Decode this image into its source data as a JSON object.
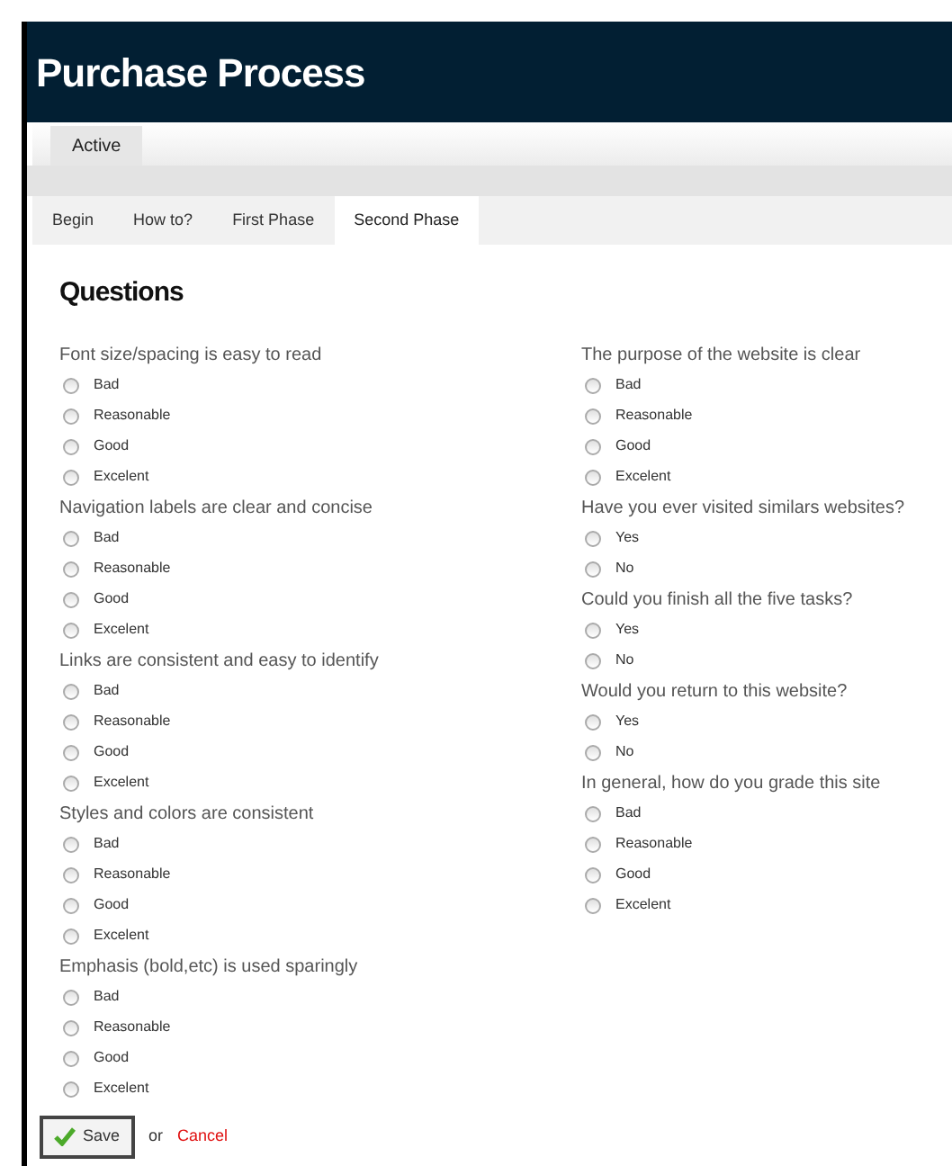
{
  "header": {
    "title": "Purchase Process"
  },
  "top_tabs": [
    {
      "label": "Active",
      "selected": true
    }
  ],
  "phase_tabs": [
    {
      "label": "Begin",
      "selected": false
    },
    {
      "label": "How to?",
      "selected": false
    },
    {
      "label": "First Phase",
      "selected": false
    },
    {
      "label": "Second Phase",
      "selected": true
    }
  ],
  "section_title": "Questions",
  "columns": [
    [
      {
        "question": "Font size/spacing is easy to read",
        "options": [
          {
            "label": "Bad",
            "selected": false
          },
          {
            "label": "Reasonable",
            "selected": false
          },
          {
            "label": "Good",
            "selected": false
          },
          {
            "label": "Excelent",
            "selected": false
          }
        ]
      },
      {
        "question": "Navigation labels are clear and concise",
        "options": [
          {
            "label": "Bad",
            "selected": false
          },
          {
            "label": "Reasonable",
            "selected": false
          },
          {
            "label": "Good",
            "selected": false
          },
          {
            "label": "Excelent",
            "selected": false
          }
        ]
      },
      {
        "question": "Links are consistent and easy to identify",
        "options": [
          {
            "label": "Bad",
            "selected": false
          },
          {
            "label": "Reasonable",
            "selected": false
          },
          {
            "label": "Good",
            "selected": false
          },
          {
            "label": "Excelent",
            "selected": false
          }
        ]
      },
      {
        "question": "Styles and colors are consistent",
        "options": [
          {
            "label": "Bad",
            "selected": false
          },
          {
            "label": "Reasonable",
            "selected": false
          },
          {
            "label": "Good",
            "selected": false
          },
          {
            "label": "Excelent",
            "selected": false
          }
        ]
      },
      {
        "question": "Emphasis (bold,etc) is used sparingly",
        "options": [
          {
            "label": "Bad",
            "selected": false
          },
          {
            "label": "Reasonable",
            "selected": false
          },
          {
            "label": "Good",
            "selected": false
          },
          {
            "label": "Excelent",
            "selected": false
          }
        ]
      }
    ],
    [
      {
        "question": "The purpose of the website is clear",
        "options": [
          {
            "label": "Bad",
            "selected": false
          },
          {
            "label": "Reasonable",
            "selected": false
          },
          {
            "label": "Good",
            "selected": false
          },
          {
            "label": "Excelent",
            "selected": false
          }
        ]
      },
      {
        "question": "Have you ever visited similars websites?",
        "options": [
          {
            "label": "Yes",
            "selected": false
          },
          {
            "label": "No",
            "selected": false
          }
        ]
      },
      {
        "question": "Could you finish all the five tasks?",
        "options": [
          {
            "label": "Yes",
            "selected": false
          },
          {
            "label": "No",
            "selected": false
          }
        ]
      },
      {
        "question": "Would you return to this website?",
        "options": [
          {
            "label": "Yes",
            "selected": false
          },
          {
            "label": "No",
            "selected": false
          }
        ]
      },
      {
        "question": "In general, how do you grade this site",
        "options": [
          {
            "label": "Bad",
            "selected": false
          },
          {
            "label": "Reasonable",
            "selected": false
          },
          {
            "label": "Good",
            "selected": false
          },
          {
            "label": "Excelent",
            "selected": false
          }
        ]
      }
    ]
  ],
  "actions": {
    "save": "Save",
    "separator": "or",
    "cancel": "Cancel"
  }
}
